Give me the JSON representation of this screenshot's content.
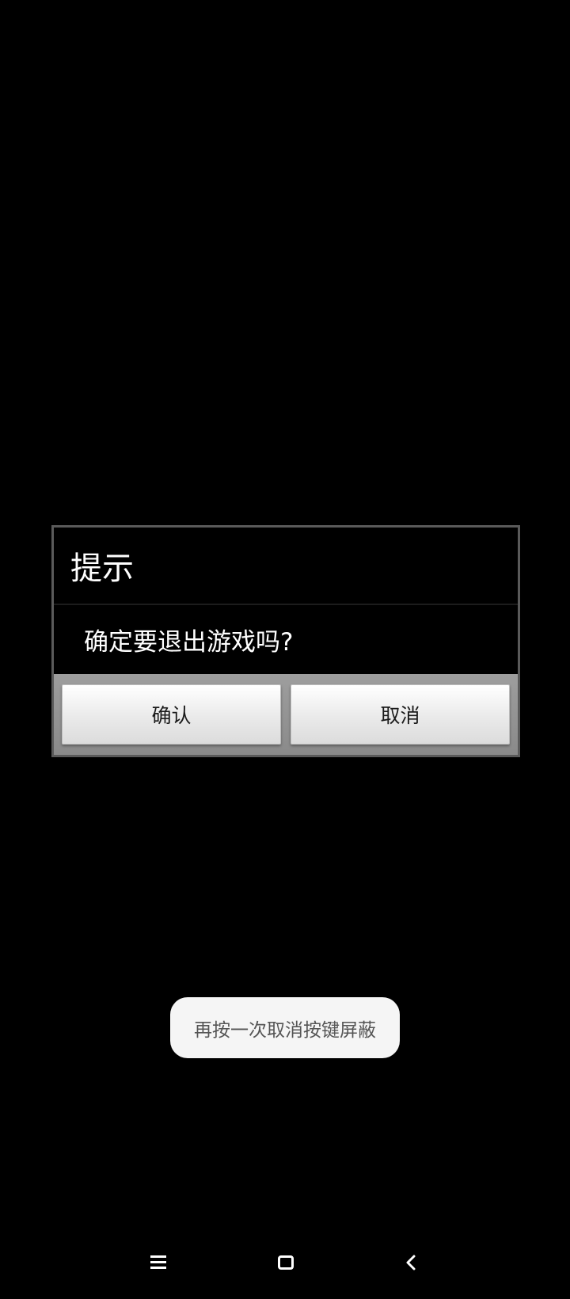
{
  "dialog": {
    "title": "提示",
    "message": "确定要退出游戏吗?",
    "confirm_label": "确认",
    "cancel_label": "取消"
  },
  "toast": {
    "text": "再按一次取消按键屏蔽"
  },
  "nav_bar": {
    "icons": [
      "menu-icon",
      "home-icon",
      "back-icon"
    ]
  },
  "colors": {
    "background": "#000000",
    "dialog_border": "#5a5a5a",
    "button_bar": "#8e8e8e",
    "toast_bg": "#f5f5f5"
  }
}
